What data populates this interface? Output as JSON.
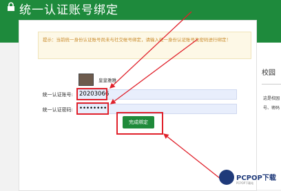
{
  "header": {
    "title": "统一认证账号绑定",
    "color": "#1e8a3c"
  },
  "notice": {
    "text": "提示：当前统一身份认证账号尚未与社交帐号绑定，请输入统一身份认证账号及密码进行绑定！"
  },
  "user": {
    "name": "皇皇雅雅"
  },
  "form": {
    "account_label": "统一认证账号:",
    "account_value": "20203066",
    "password_label": "统一认证密码:",
    "password_value": "••••••••",
    "submit_label": "完成绑定"
  },
  "side_panel": {
    "title": "校园",
    "line1": "这是校园",
    "line2": "号、密码"
  },
  "watermark": {
    "brand": "PCPOP下载",
    "sub": "PCPOP下载站"
  },
  "annotation_color": "#e0202a"
}
